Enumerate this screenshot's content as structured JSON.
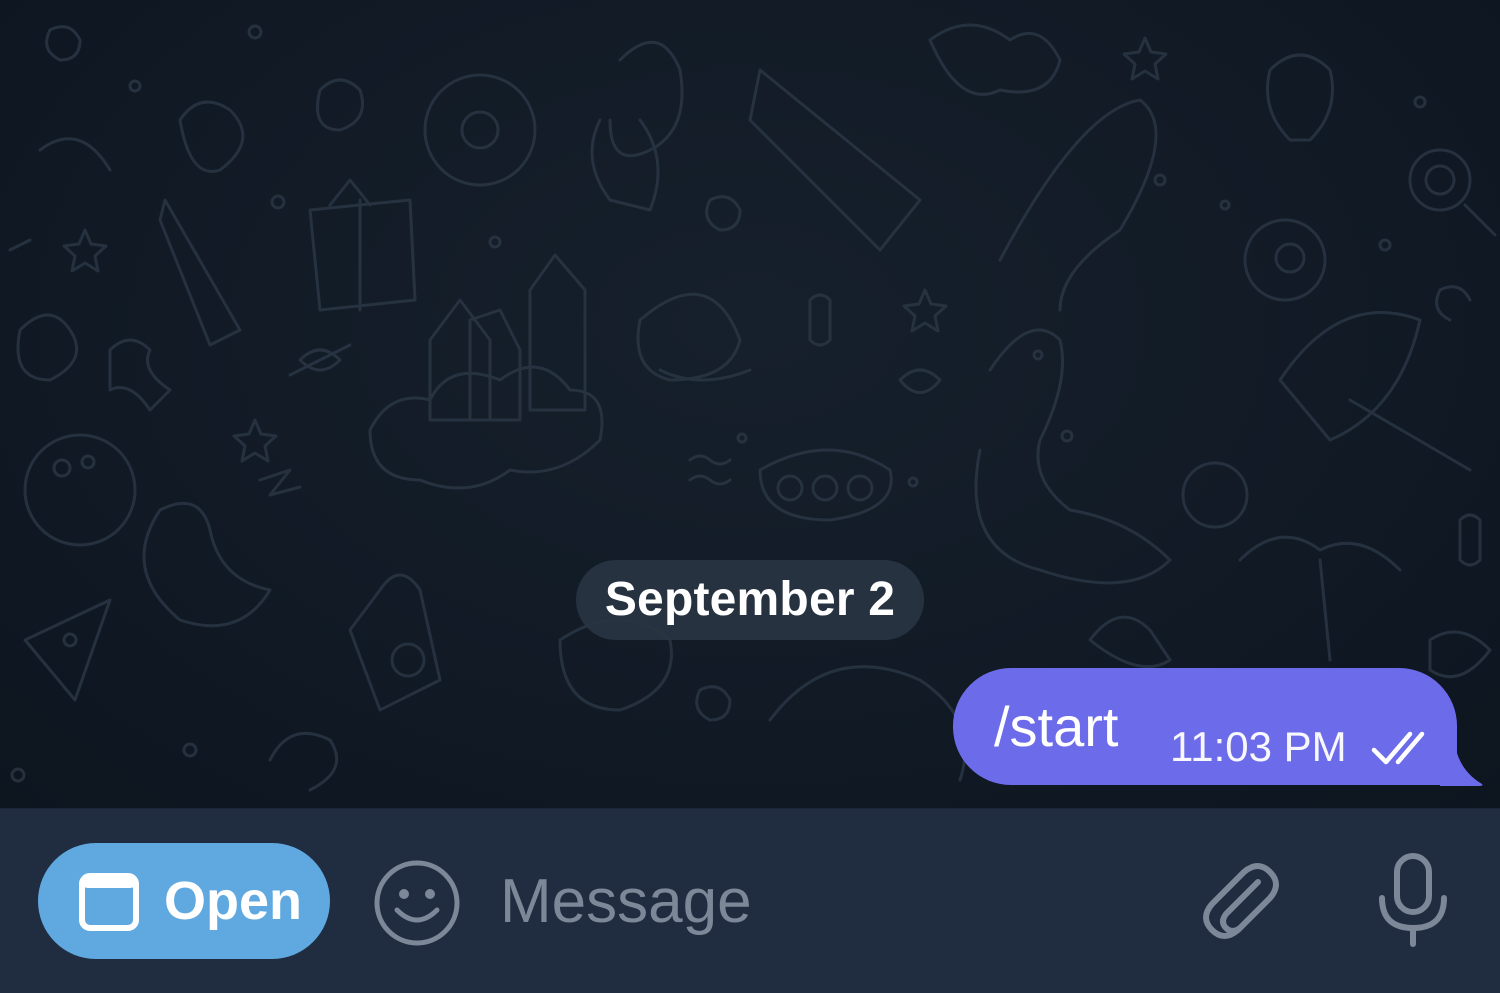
{
  "chat": {
    "date_separator": "September 2",
    "messages": [
      {
        "text": "/start",
        "time": "11:03 PM",
        "status_icon": "double-check-icon",
        "outgoing": true
      }
    ]
  },
  "input_bar": {
    "open_button_label": "Open",
    "open_button_icon": "window-icon",
    "placeholder": "Message",
    "value": "",
    "icons": [
      "emoji-icon",
      "paperclip-icon",
      "microphone-icon"
    ]
  },
  "colors": {
    "chat_background": "#111a25",
    "outgoing_bubble": "#6c6ceb",
    "input_bar": "#202c40",
    "open_button": "#5fa9e0",
    "date_pill": "#283442",
    "icon_muted": "#7c8797"
  }
}
